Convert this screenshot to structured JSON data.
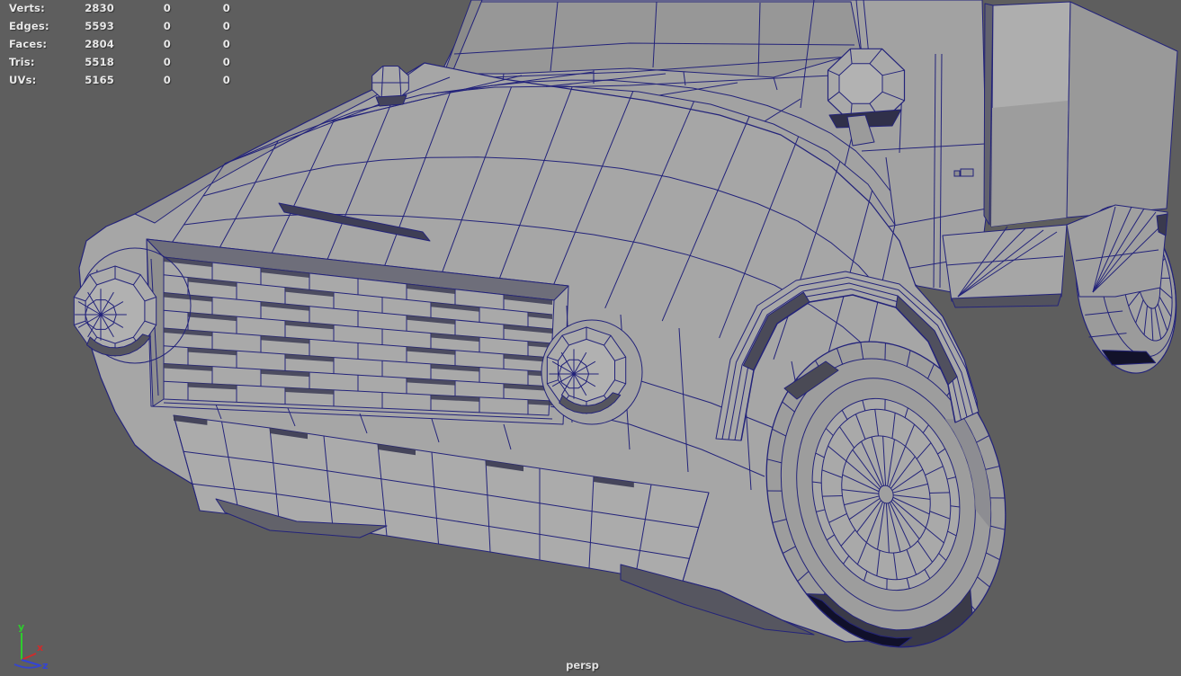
{
  "hud": {
    "text_color": "#e9e9e9",
    "rows": [
      {
        "label": "Verts:",
        "v1": "2830",
        "v2": "0",
        "v3": "0"
      },
      {
        "label": "Edges:",
        "v1": "5593",
        "v2": "0",
        "v3": "0"
      },
      {
        "label": "Faces:",
        "v1": "2804",
        "v2": "0",
        "v3": "0"
      },
      {
        "label": "Tris:",
        "v1": "5518",
        "v2": "0",
        "v3": "0"
      },
      {
        "label": "UVs:",
        "v1": "5165",
        "v2": "0",
        "v3": "0"
      }
    ]
  },
  "camera": {
    "label": "persp",
    "text_color": "#e2e2e2"
  },
  "axis_gizmo": {
    "x_label": "x",
    "y_label": "y",
    "z_label": "z",
    "x_color": "#cf2b2b",
    "y_color": "#2ecc2e",
    "z_color": "#3344d6"
  },
  "viewport": {
    "background_color": "#5e5e5e",
    "model_fill_color": "#a6a6a6",
    "wireframe_color": "#23237a",
    "subject": "low-poly-pickup-truck-wireframe"
  }
}
